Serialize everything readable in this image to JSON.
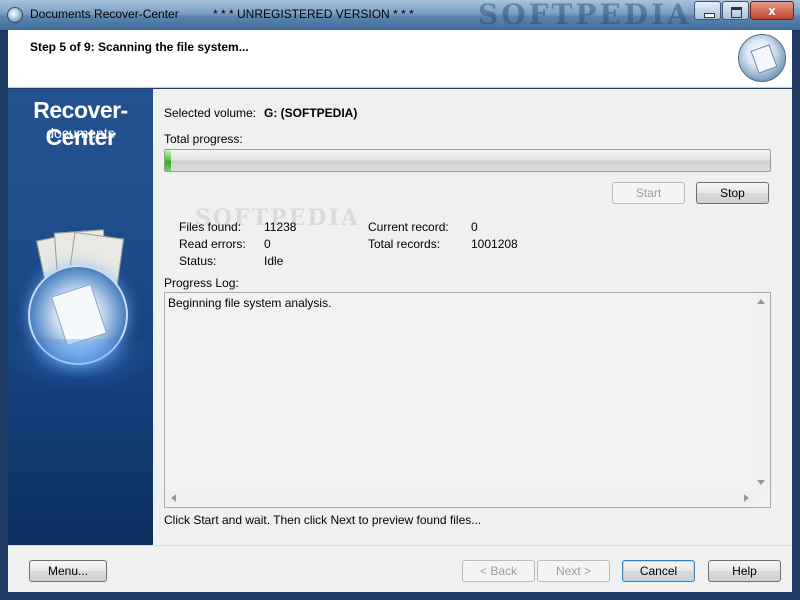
{
  "window": {
    "title": "Documents Recover-Center",
    "unregistered": "* * * UNREGISTERED VERSION * * *",
    "watermark": "SOFTPEDIA",
    "close_symbol": "x"
  },
  "header": {
    "step": "Step 5 of 9: Scanning the file system..."
  },
  "brand": {
    "line1": "Recover-Center",
    "line2": "documents"
  },
  "volume": {
    "label": "Selected volume:",
    "value": "G: (SOFTPEDIA)"
  },
  "progress": {
    "label": "Total progress:",
    "fraction": 0.01
  },
  "buttons": {
    "start": "Start",
    "stop": "Stop",
    "menu": "Menu...",
    "back": "< Back",
    "next": "Next >",
    "cancel": "Cancel",
    "help": "Help"
  },
  "stats": {
    "files_found_label": "Files found:",
    "files_found": "11238",
    "read_errors_label": "Read errors:",
    "read_errors": "0",
    "status_label": "Status:",
    "status": "Idle",
    "current_record_label": "Current record:",
    "current_record": "0",
    "total_records_label": "Total records:",
    "total_records": "1001208"
  },
  "log": {
    "label": "Progress Log:",
    "lines": [
      "Beginning file system analysis."
    ]
  },
  "hint": "Click Start and wait. Then click Next to preview found files..."
}
